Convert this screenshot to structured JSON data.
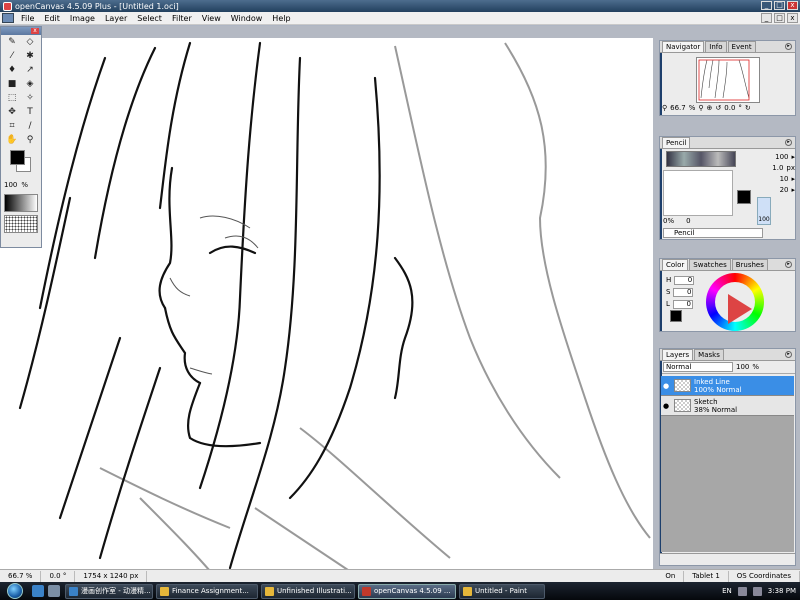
{
  "window": {
    "title": "openCanvas 4.5.09 Plus - [Untitled 1.oci]",
    "min": "_",
    "max": "□",
    "close": "x"
  },
  "menu": {
    "items": [
      "File",
      "Edit",
      "Image",
      "Layer",
      "Select",
      "Filter",
      "View",
      "Window",
      "Help"
    ]
  },
  "toolbox": {
    "close": "x",
    "opacity_value": "100",
    "opacity_unit": "%"
  },
  "navigator": {
    "tabs": [
      "Navigator",
      "Info",
      "Event"
    ],
    "zoom": "66.7",
    "zoom_unit": "%",
    "rotation": "0.0",
    "rotation_unit": "°"
  },
  "pencil": {
    "tab": "Pencil",
    "opacity": "100",
    "size": "1.0",
    "size_unit": "px",
    "density": "10",
    "hardness": "20",
    "preset_min": "0%",
    "preset_zero": "0",
    "preset_max": "100",
    "name": "Pencil"
  },
  "color": {
    "tabs": [
      "Color",
      "Swatches",
      "Brushes"
    ],
    "h_label": "H",
    "s_label": "S",
    "l_label": "L",
    "h": "0",
    "s": "0",
    "l": "0"
  },
  "layers": {
    "tabs": [
      "Layers",
      "Masks"
    ],
    "blend_mode": "Normal",
    "opacity": "100",
    "opacity_unit": "%",
    "items": [
      {
        "name": "Inked Line",
        "detail": "100% Normal",
        "selected": true
      },
      {
        "name": "Sketch",
        "detail": "38% Normal",
        "selected": false
      }
    ]
  },
  "status": {
    "zoom": "66.7 %",
    "angle": "0.0 °",
    "size": "1754 x 1240 px",
    "pen": "On",
    "tablet": "Tablet 1",
    "coords": "OS Coordinates"
  },
  "taskbar": {
    "tasks": [
      {
        "label": "漫画创作室 - 动漫精...",
        "color": "#3a82c8"
      },
      {
        "label": "Finance Assignment...",
        "color": "#e6b73a"
      },
      {
        "label": "Unfinished Illustrati...",
        "color": "#e6b73a"
      },
      {
        "label": "openCanvas 4.5.09 ...",
        "color": "#c0392b",
        "active": true
      },
      {
        "label": "Untitled - Paint",
        "color": "#e6b73a"
      }
    ],
    "lang": "EN",
    "clock": "3:38 PM"
  }
}
